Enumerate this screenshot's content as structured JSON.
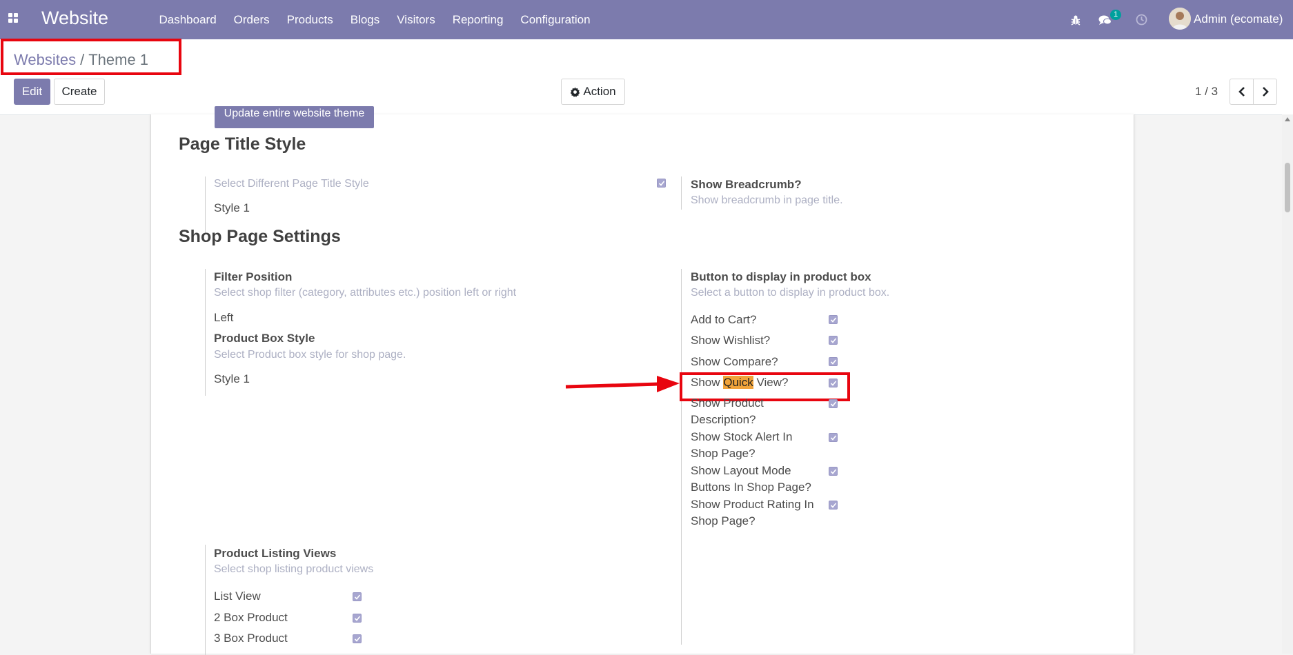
{
  "navbar": {
    "brand": "Website",
    "menu": [
      "Dashboard",
      "Orders",
      "Products",
      "Blogs",
      "Visitors",
      "Reporting",
      "Configuration"
    ],
    "messages_count": "1",
    "user": "Admin (ecomate)"
  },
  "control": {
    "breadcrumb_parent": "Websites",
    "breadcrumb_sep": "/",
    "breadcrumb_current": "Theme 1",
    "edit_label": "Edit",
    "create_label": "Create",
    "action_label": "Action",
    "pager": "1 / 3"
  },
  "form": {
    "update_button": "Update entire website theme",
    "page_title_section": "Page Title Style",
    "page_title_style_label": "Select Different Page Title Style",
    "page_title_style_value": "Style 1",
    "breadcrumb_label": "Show Breadcrumb?",
    "breadcrumb_help": "Show breadcrumb in page title.",
    "shop_section": "Shop Page Settings",
    "filter_position_label": "Filter Position",
    "filter_position_help": "Select shop filter (category, attributes etc.) position left or right",
    "filter_position_value": "Left",
    "product_box_label": "Product Box Style",
    "product_box_help": "Select Product box style for shop page.",
    "product_box_value": "Style 1",
    "button_display_label": "Button to display in product box",
    "button_display_help": "Select a button to display in product box.",
    "button_options": [
      {
        "label": "Add to Cart?",
        "checked": true
      },
      {
        "label": "Show Wishlist?",
        "checked": true
      },
      {
        "label": "Show Compare?",
        "checked": true
      },
      {
        "label_pre": "Show ",
        "label_hl": "Quick",
        "label_post": " View?",
        "checked": true
      },
      {
        "line1": "Show Product",
        "line2": "Description?",
        "checked": true
      },
      {
        "line1": "Show Stock Alert In",
        "line2": "Shop Page?",
        "checked": true
      },
      {
        "line1": "Show Layout Mode",
        "line2": "Buttons In Shop Page?",
        "checked": true
      },
      {
        "line1": "Show Product Rating In",
        "line2": "Shop Page?",
        "checked": true
      }
    ],
    "listing_label": "Product Listing Views",
    "listing_help": "Select shop listing product views",
    "listing_options": [
      {
        "label": "List View",
        "checked": true
      },
      {
        "label": "2 Box Product",
        "checked": true
      },
      {
        "label": "3 Box Product",
        "checked": true
      }
    ]
  },
  "colors": {
    "brand": "#7c7bad",
    "annotation": "#e8050f",
    "search_highlight": "#f0a33a"
  },
  "icons": {
    "apps": "apps-grid-icon",
    "bug": "bug-icon",
    "chat": "chat-icon",
    "activity": "clock-icon",
    "action": "gear-icon",
    "prev": "chevron-left-icon",
    "next": "chevron-right-icon"
  }
}
